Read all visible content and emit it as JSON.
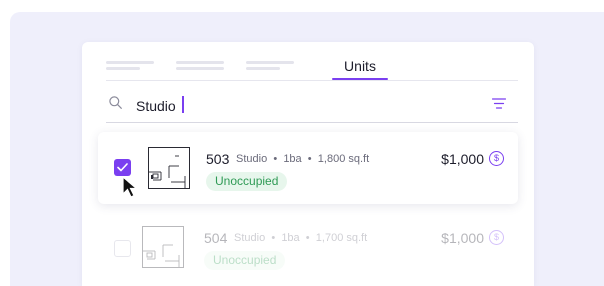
{
  "tabs": {
    "active_label": "Units",
    "placeholders": [
      "tab-1",
      "tab-2",
      "tab-3"
    ]
  },
  "search": {
    "value": "Studio",
    "icon": "search-icon",
    "filter_icon": "filter-icon"
  },
  "units": [
    {
      "number": "503",
      "type": "Studio",
      "baths": "1ba",
      "area": "1,800 sq.ft",
      "status": "Unoccupied",
      "price": "$1,000",
      "selected": true
    },
    {
      "number": "504",
      "type": "Studio",
      "baths": "1ba",
      "area": "1,700 sq.ft",
      "status": "Unoccupied",
      "price": "$1,000",
      "selected": false
    }
  ],
  "separator": "•",
  "colors": {
    "accent": "#7a3ff0",
    "backdrop": "#efeffb",
    "status_bg": "#e7f6ec",
    "status_text": "#2f9a55"
  }
}
